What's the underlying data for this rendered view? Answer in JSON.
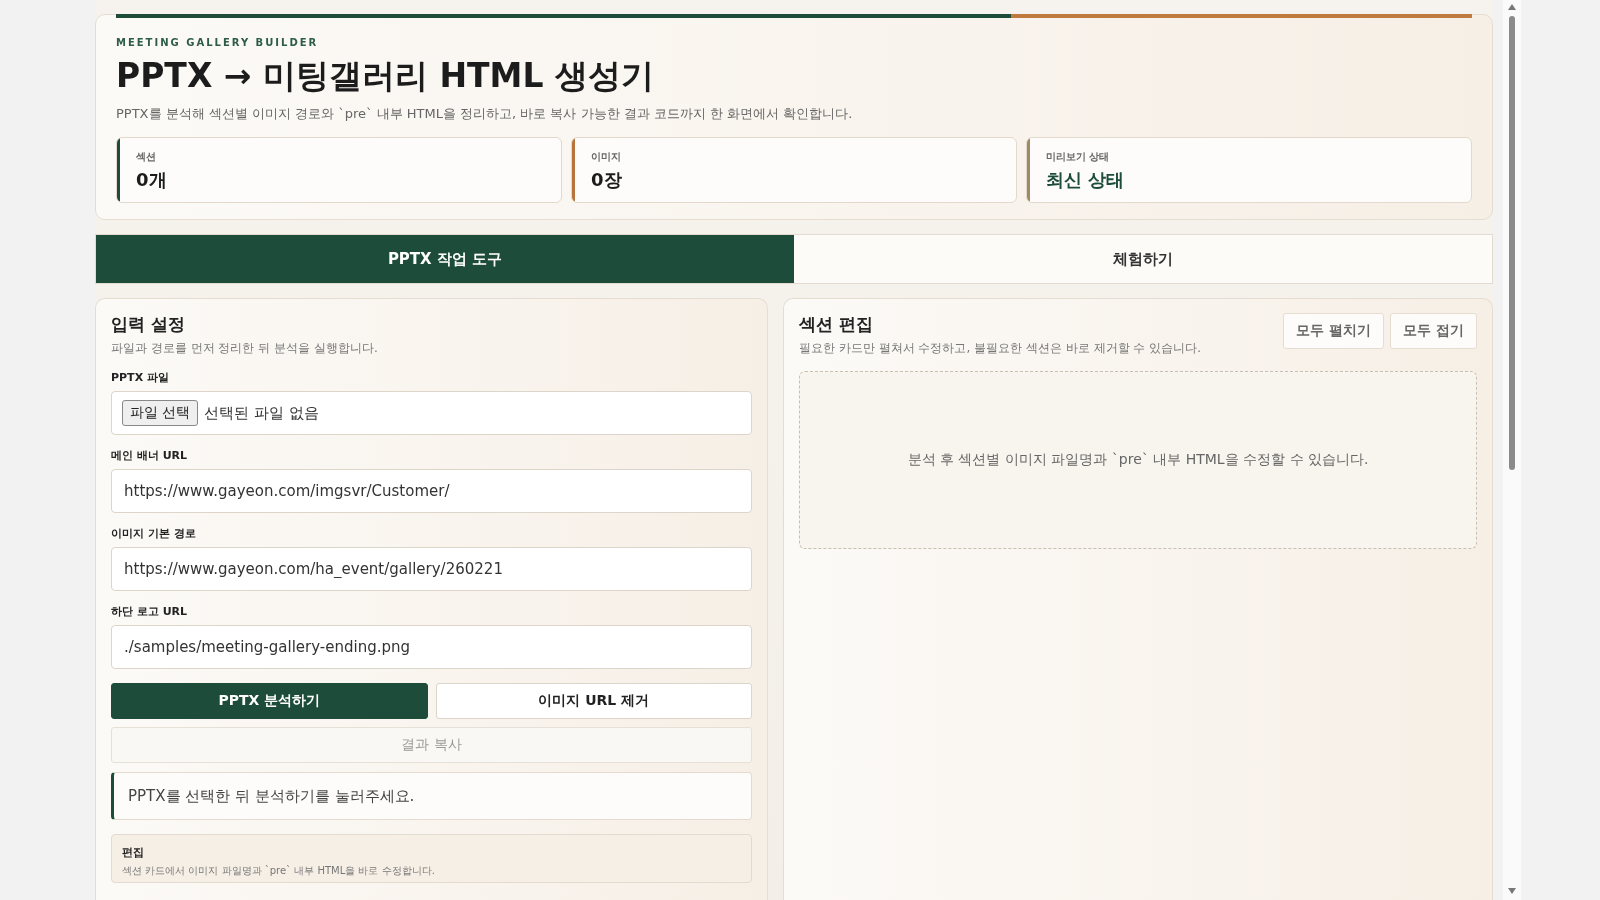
{
  "header": {
    "eyebrow": "MEETING GALLERY BUILDER",
    "title": "PPTX → 미팅갤러리 HTML 생성기",
    "description": "PPTX를 분석해 섹션별 이미지 경로와 `pre` 내부 HTML을 정리하고, 바로 복사 가능한 결과 코드까지 한 화면에서 확인합니다.",
    "stats": [
      {
        "label": "섹션",
        "value": "0개",
        "color": "#1d4d3a"
      },
      {
        "label": "이미지",
        "value": "0장",
        "color": "#b8743a"
      },
      {
        "label": "미리보기 상태",
        "value": "최신 상태",
        "color": "#a08a65"
      }
    ]
  },
  "tabs": [
    {
      "label": "PPTX 작업 도구",
      "selected": true
    },
    {
      "label": "체험하기",
      "selected": false
    }
  ],
  "input_panel": {
    "title": "입력 설정",
    "description": "파일과 경로를 먼저 정리한 뒤 분석을 실행합니다.",
    "fields": [
      {
        "kind": "file",
        "label": "PPTX 파일",
        "button": "파일 선택",
        "value": "선택된 파일 없음"
      },
      {
        "kind": "text",
        "label": "메인 배너 URL",
        "value": "https://www.gayeon.com/imgsvr/Customer/"
      },
      {
        "kind": "text",
        "label": "이미지 기본 경로",
        "value": "https://www.gayeon.com/ha_event/gallery/260221"
      },
      {
        "kind": "text",
        "label": "하단 로고 URL",
        "value": "./samples/meeting-gallery-ending.png"
      }
    ],
    "actions": [
      {
        "label": "PPTX 분석하기",
        "kind": "primary",
        "disabled": false
      },
      {
        "label": "이미지 URL 제거",
        "kind": "secondary",
        "disabled": false
      }
    ],
    "copy_button": {
      "label": "결과 복사",
      "disabled": true
    },
    "status_message": "PPTX를 선택한 뒤 분석하기를 눌러주세요.",
    "edit_card": {
      "title": "편집",
      "description": "섹션 카드에서 이미지 파일명과 `pre` 내부 HTML을 바로 수정합니다."
    }
  },
  "section_panel": {
    "title": "섹션 편집",
    "description": "필요한 카드만 펼쳐서 수정하고, 불필요한 섹션은 바로 제거할 수 있습니다.",
    "buttons": [
      "모두 펼치기",
      "모두 접기"
    ],
    "empty_message": "분석 후 섹션별 이미지 파일명과 `pre` 내부 HTML을 수정할 수 있습니다."
  }
}
